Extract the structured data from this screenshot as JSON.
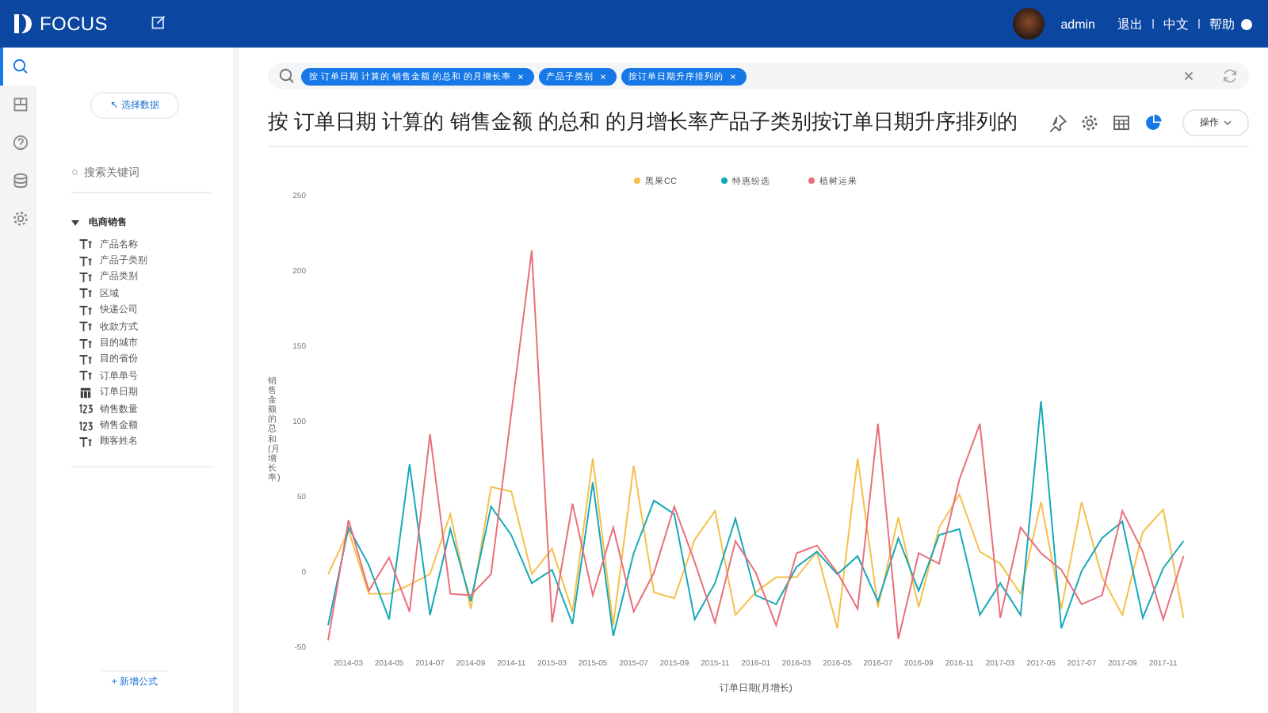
{
  "header": {
    "logo": "FOCUS",
    "user": "admin",
    "links": [
      "退出",
      "中文",
      "帮助"
    ]
  },
  "rail": {
    "items": [
      {
        "selected": true
      },
      {
        "selected": false
      },
      {
        "selected": false
      },
      {
        "selected": false
      },
      {
        "selected": false
      }
    ]
  },
  "data_panel": {
    "select_button": "↖ 选择数据",
    "search": {
      "placeholder": "搜索关键词"
    },
    "group": {
      "label": "电商销售",
      "expanded": true,
      "children": [
        {
          "kind": "text",
          "label": "产品名称"
        },
        {
          "kind": "text",
          "label": "产品子类别"
        },
        {
          "kind": "text",
          "label": "产品类别"
        },
        {
          "kind": "text",
          "label": "区域"
        },
        {
          "kind": "text",
          "label": "快递公司"
        },
        {
          "kind": "text",
          "label": "收款方式"
        },
        {
          "kind": "text",
          "label": "目的城市"
        },
        {
          "kind": "text",
          "label": "目的省份"
        },
        {
          "kind": "text",
          "label": "订单单号"
        },
        {
          "kind": "date",
          "label": "订单日期"
        },
        {
          "kind": "number",
          "label": "销售数量"
        },
        {
          "kind": "number",
          "label": "销售金额"
        },
        {
          "kind": "text",
          "label": "顾客姓名"
        }
      ]
    },
    "add_button": "+ 新增公式"
  },
  "search_bar": {
    "tags": [
      "按 订单日期 计算的 销售金额 的总和 的月增长率",
      "产品子类别",
      "按订单日期升序排列的"
    ]
  },
  "title": "按 订单日期 计算的 销售金额 的总和 的月增长率产品子类别按订单日期升序排列的",
  "view_icons": [
    {
      "selected": false
    },
    {
      "selected": false
    },
    {
      "selected": false
    },
    {
      "selected": true
    }
  ],
  "action_button": "操作",
  "chart_data": {
    "type": "line",
    "xlabel": "订单日期(月增长)",
    "ylabel": "销售金额的总和(月增长率)",
    "legend": "top",
    "categories": [
      null,
      "2014-03",
      null,
      "2014-05",
      null,
      "2014-07",
      null,
      "2014-09",
      null,
      "2014-11",
      null,
      "2015-03",
      null,
      "2015-05",
      null,
      "2015-07",
      null,
      "2015-09",
      null,
      "2015-11",
      null,
      "2016-01",
      null,
      "2016-03",
      null,
      "2016-05",
      null,
      "2016-07",
      null,
      "2016-09",
      null,
      "2016-11",
      null,
      "2017-03",
      null,
      "2017-05",
      null,
      "2017-07",
      null,
      "2017-09",
      null,
      "2017-11",
      null
    ],
    "series": [
      {
        "name": "黑果CC",
        "color": "#f5c04a",
        "values": [
          -2,
          27,
          -15,
          -15,
          -9,
          -2,
          38,
          -25,
          56,
          53,
          -2,
          15,
          -27,
          75,
          -36,
          70,
          -14,
          -18,
          21,
          40,
          -29,
          -14,
          -4,
          -4,
          13,
          -38,
          75,
          -24,
          36,
          -24,
          29,
          51,
          13,
          5,
          -15,
          46,
          -25,
          46,
          -4,
          -29,
          26,
          41,
          -31
        ]
      },
      {
        "name": "特惠纷选",
        "color": "#16a9b8",
        "values": [
          -36,
          29,
          4,
          -32,
          71,
          -29,
          28,
          -20,
          43,
          24,
          -8,
          1,
          -35,
          59,
          -43,
          12,
          47,
          38,
          -32,
          -8,
          35,
          -16,
          -22,
          3,
          13,
          -2,
          10,
          -20,
          22,
          -13,
          24,
          28,
          -29,
          -8,
          -29,
          113,
          -38,
          0,
          22,
          33,
          -31,
          2,
          20
        ]
      },
      {
        "name": "植树运果",
        "color": "#e8707a",
        "values": [
          -46,
          34,
          -13,
          9,
          -27,
          91,
          -15,
          -16,
          -2,
          105,
          213,
          -34,
          45,
          -16,
          29,
          -27,
          -1,
          43,
          6,
          -34,
          20,
          -1,
          -36,
          12,
          17,
          -1,
          -25,
          98,
          -45,
          12,
          5,
          61,
          98,
          -31,
          29,
          12,
          1,
          -22,
          -16,
          40,
          13,
          -32,
          10
        ]
      }
    ],
    "ylim": [
      -50,
      250
    ],
    "yticks": [
      -50,
      0,
      50,
      100,
      150,
      200,
      250
    ]
  }
}
